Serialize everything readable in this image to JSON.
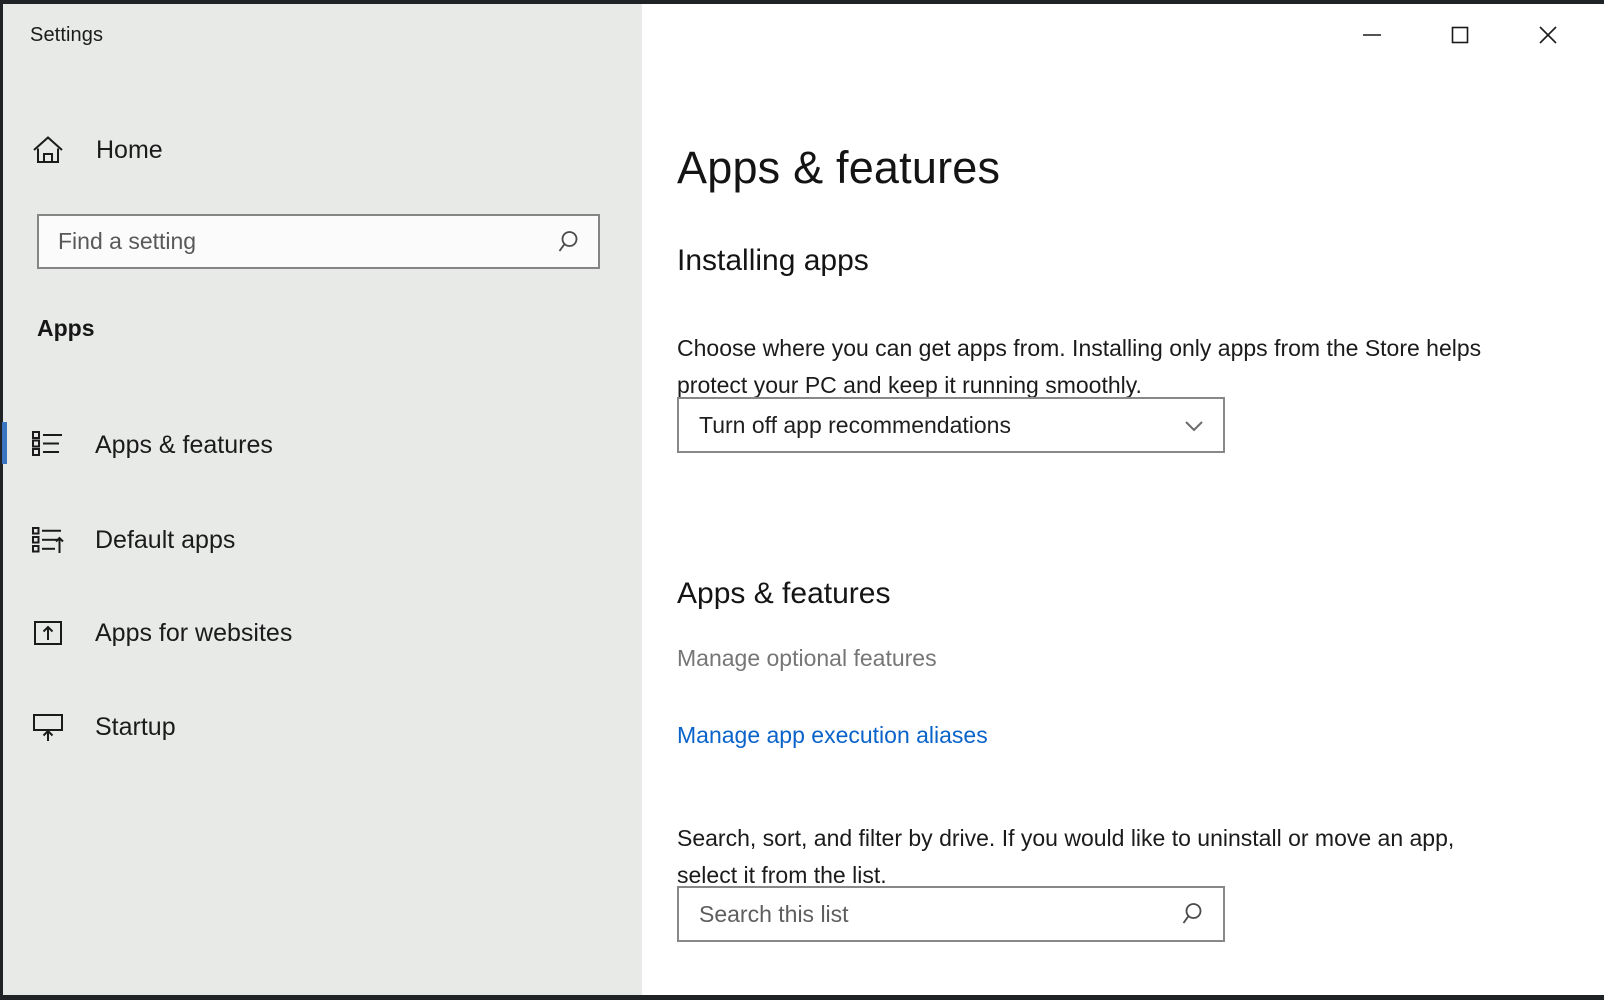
{
  "window": {
    "title": "Settings",
    "controls": {
      "minimize": "Minimize",
      "maximize": "Maximize",
      "close": "Close"
    }
  },
  "sidebar": {
    "home_label": "Home",
    "search": {
      "placeholder": "Find a setting",
      "value": ""
    },
    "group_header": "Apps",
    "items": [
      {
        "label": "Apps & features",
        "icon": "list-bullets-icon",
        "selected": true
      },
      {
        "label": "Default apps",
        "icon": "list-arrow-icon",
        "selected": false
      },
      {
        "label": "Apps for websites",
        "icon": "box-upload-icon",
        "selected": false
      },
      {
        "label": "Startup",
        "icon": "monitor-arrow-up-icon",
        "selected": false
      }
    ]
  },
  "main": {
    "page_title": "Apps & features",
    "installing_apps": {
      "heading": "Installing apps",
      "description": "Choose where you can get apps from. Installing only apps from the Store helps protect your PC and keep it running smoothly.",
      "dropdown_value": "Turn off app recommendations"
    },
    "apps_features": {
      "heading": "Apps & features",
      "manage_optional_features": "Manage optional features",
      "manage_app_execution_aliases": "Manage app execution aliases",
      "search_description": "Search, sort, and filter by drive. If you would like to uninstall or move an app, select it from the list.",
      "search_placeholder": "Search this list",
      "search_value": ""
    }
  },
  "colors": {
    "accent": "#3a75c4",
    "link": "#0a63c9",
    "sidebar_bg": "#e8eae8",
    "content_bg": "#ffffff",
    "muted_text": "#767676"
  }
}
